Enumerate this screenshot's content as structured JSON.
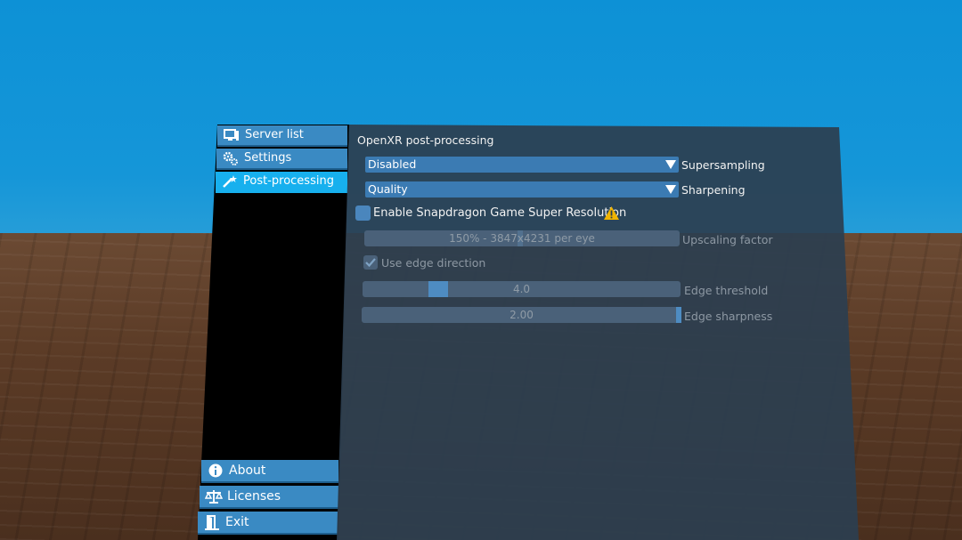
{
  "sidebar": {
    "items": [
      {
        "label": "Server list",
        "icon": "monitor-icon",
        "active": false
      },
      {
        "label": "Settings",
        "icon": "gears-icon",
        "active": false
      },
      {
        "label": "Post-processing",
        "icon": "magic-wand-icon",
        "active": true
      }
    ],
    "bottom": [
      {
        "label": "About",
        "icon": "info-icon"
      },
      {
        "label": "Licenses",
        "icon": "scales-icon"
      },
      {
        "label": "Exit",
        "icon": "exit-door-icon"
      }
    ]
  },
  "panel": {
    "title": "OpenXR post-processing",
    "supersampling": {
      "value": "Disabled",
      "label": "Supersampling"
    },
    "sharpening": {
      "value": "Quality",
      "label": "Sharpening"
    },
    "sgsr": {
      "label": "Enable Snapdragon Game Super Resolution",
      "checked": false,
      "warning_icon": "warning-icon"
    },
    "upscaling": {
      "value": "150% - 3847x4231 per eye",
      "label": "Upscaling factor"
    },
    "edge_direction": {
      "label": "Use edge direction",
      "checked": true
    },
    "edge_threshold": {
      "value": "4.0",
      "label": "Edge threshold",
      "level": 0.22
    },
    "edge_sharpness": {
      "value": "2.00",
      "label": "Edge sharpness",
      "level": 1.0
    }
  },
  "colors": {
    "sky": "#1596d8",
    "panel": "#2c3e50",
    "accent": "#3b7bb3",
    "active_item": "#17b0ee",
    "warning": "#f0b400"
  }
}
